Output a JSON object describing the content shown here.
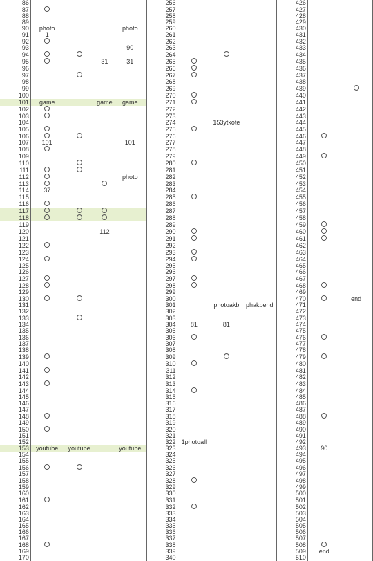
{
  "panels": [
    {
      "start": 86,
      "end": 170,
      "highlights": [
        101,
        117,
        118,
        153
      ],
      "cols": [
        {
          "key": "A",
          "width": "cA",
          "marks": {
            "87": "o",
            "92": "o",
            "94": "o",
            "95": "o",
            "101": "game",
            "102": "o",
            "103": "o",
            "105": "o",
            "106": "o",
            "107": "101",
            "108": "o",
            "111": "o",
            "112": "o",
            "113": "o",
            "114": "37",
            "116": "o",
            "117": "o",
            "118": "o",
            "122": "o",
            "124": "o",
            "127": "o",
            "128": "o",
            "130": "o",
            "139": "o",
            "141": "o",
            "143": "o",
            "148": "o",
            "150": "o",
            "153": "youtube",
            "156": "o",
            "161": "o",
            "168": "o",
            "90": "photo",
            "91": "1"
          }
        },
        {
          "key": "B",
          "width": "cB",
          "marks": {
            "94": "o",
            "97": "o",
            "106": "o",
            "110": "o",
            "111": "o",
            "117": "o",
            "118": "o",
            "130": "o",
            "133": "o",
            "153": "youtube",
            "156": "o"
          }
        },
        {
          "key": "C",
          "width": "cC",
          "marks": {
            "95": "31",
            "101": "game",
            "113": "o",
            "117": "o",
            "118": "o",
            "120": "112"
          }
        },
        {
          "key": "D",
          "width": "cD",
          "marks": {
            "90": "photo",
            "93": "90",
            "95": "31",
            "101": "game",
            "107": "101",
            "112": "photo",
            "153": "youtube"
          }
        }
      ]
    },
    {
      "start": 256,
      "end": 340,
      "highlights": [],
      "cols": [
        {
          "key": "E",
          "width": "cA",
          "marks": {
            "265": "o",
            "266": "o",
            "267": "o",
            "270": "o",
            "271": "o",
            "275": "o",
            "280": "o",
            "285": "o",
            "290": "o",
            "291": "o",
            "293": "o",
            "294": "o",
            "297": "o",
            "298": "o",
            "304": "81",
            "306": "o",
            "310": "o",
            "314": "o",
            "322": "1photoall",
            "328": "o",
            "332": "o"
          }
        },
        {
          "key": "F",
          "width": "cB",
          "marks": {
            "264": "o",
            "274": "153ytkote",
            "301": "photoakb",
            "304": "81",
            "309": "o"
          }
        },
        {
          "key": "G",
          "width": "cD",
          "marks": {
            "301": "phakbend"
          }
        }
      ]
    },
    {
      "start": 426,
      "end": 510,
      "highlights": [],
      "cols": [
        {
          "key": "H",
          "width": "cA",
          "marks": {
            "446": "o",
            "449": "o",
            "459": "o",
            "460": "o",
            "461": "o",
            "468": "o",
            "470": "o",
            "476": "o",
            "479": "o",
            "488": "o",
            "493": "90",
            "508": "o",
            "509": "end"
          }
        },
        {
          "key": "I",
          "width": "cD",
          "marks": {
            "439": "o",
            "470": "end"
          }
        }
      ]
    }
  ]
}
